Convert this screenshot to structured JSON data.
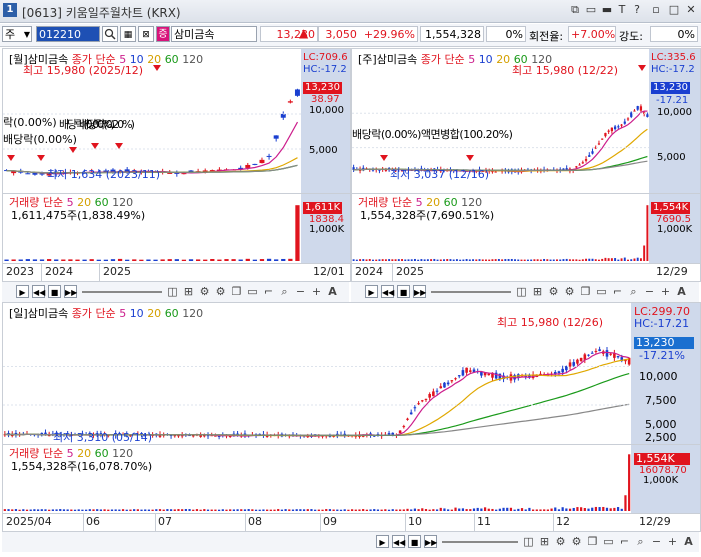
{
  "window": {
    "number": "1",
    "title": "[0613] 키움일주월차트 (KRX)",
    "controls": [
      "⧉",
      "▭",
      "▬",
      "T",
      "?",
      "▫",
      "□",
      "✕"
    ]
  },
  "toolbar": {
    "market": "주",
    "code": "012210",
    "tag": "증",
    "name": "삼미금속",
    "price": "13,230",
    "change": "3,050",
    "change_pct": "+29.96%",
    "volume": "1,554,328",
    "vol_pct": "0%",
    "turnover_label": "회전율:",
    "turnover": "+7.00%",
    "strength_label": "강도:",
    "strength": "0%"
  },
  "ma_legend": {
    "name": "삼미금속",
    "price": "종가",
    "type": "단순",
    "p5": "5",
    "p10": "10",
    "p20": "20",
    "p60": "60",
    "p120": "120"
  },
  "vol_legend": {
    "title": "거래량",
    "type": "단순",
    "p5": "5",
    "p20": "20",
    "p60": "60",
    "p120": "120"
  },
  "monthly": {
    "period": "[월]",
    "lc": "LC:709.6",
    "hc": "HC:-17.2",
    "price_box": "13,230",
    "pct": "38.97",
    "y10000": "10,000",
    "y5000": "5,000",
    "high": "최고 15,980 (2025/12)",
    "low": "최저 1,634 (2023/11)",
    "events": [
      "배당락(0.00%)",
      "배당락(0.00%)",
      "배당락(0.00%)",
      "배당락(0.20%)",
      "액면병합(100.20%)"
    ],
    "event_left": "락(0.00%)",
    "event_left2": "배당락(0.00%)",
    "volume_text": "1,611,475주(1,838.49%)",
    "vol_box": "1,611K",
    "vol_pct": "1838.4",
    "vol_y": "1,000K",
    "x": [
      "2023",
      "2024",
      "2025"
    ],
    "date": "12/01"
  },
  "weekly": {
    "period": "[주]",
    "lc": "LC:335.6",
    "hc": "HC:-17.2",
    "price_box": "13,230",
    "pct": "-17.21",
    "y10000": "10,000",
    "y5000": "5,000",
    "high": "최고 15,980 (12/22)",
    "low": "최저 3,037 (12/16)",
    "event": "배당락(0.00%)액면병합(100.20%)",
    "volume_text": "1,554,328주(7,690.51%)",
    "vol_box": "1,554K",
    "vol_pct": "7690.5",
    "vol_y": "1,000K",
    "x": [
      "2024",
      "2025"
    ],
    "date": "12/29"
  },
  "daily": {
    "period": "[일]",
    "lc": "LC:299.70",
    "hc": "HC:-17.21",
    "price_box": "13,230",
    "pct": "-17.21%",
    "y10000": "10,000",
    "y7500": "7,500",
    "y5000": "5,000",
    "y2500": "2,500",
    "high": "최고 15,980 (12/26)",
    "low": "최저 3,310 (05/14)",
    "volume_text": "1,554,328주(16,078.70%)",
    "vol_box": "1,554K",
    "vol_pct": "16078.70",
    "vol_y": "1,000K",
    "x": [
      "2025/04",
      "06",
      "07",
      "08",
      "09",
      "10",
      "11",
      "12"
    ],
    "date": "12/29"
  },
  "colors": {
    "up": "#e0141e",
    "down": "#1a3fd0",
    "ma5": "#cc1e8c",
    "ma20": "#e0a800",
    "ma60": "#1a9a1a",
    "ma120": "#888888",
    "axis": "#cfd9eb"
  }
}
